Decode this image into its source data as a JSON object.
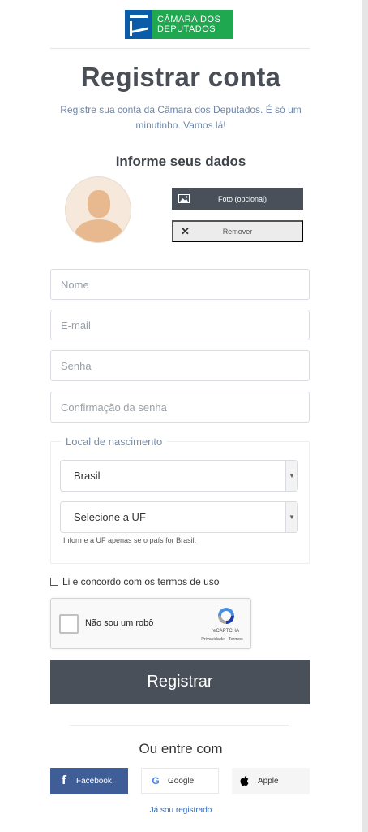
{
  "logo": {
    "line1": "CÂMARA DOS",
    "line2": "DEPUTADOS"
  },
  "title": "Registrar conta",
  "subtitle": "Registre sua conta da Câmara dos Deputados. É só um minutinho. Vamos lá!",
  "section_title": "Informe seus dados",
  "photo": {
    "upload_label": "Foto (opcional)",
    "remove_label": "Remover"
  },
  "form": {
    "name_placeholder": "Nome",
    "email_placeholder": "E-mail",
    "password_placeholder": "Senha",
    "confirm_placeholder": "Confirmação da senha"
  },
  "birthplace": {
    "legend": "Local de nascimento",
    "country_value": "Brasil",
    "uf_value": "Selecione a UF",
    "hint": "Informe a UF apenas se o país for Brasil."
  },
  "terms_label": "Li e concordo com os termos de uso",
  "recaptcha": {
    "label": "Não sou um robô",
    "brand": "reCAPTCHA",
    "links": "Privacidade - Termos"
  },
  "register_button": "Registrar",
  "or_title": "Ou entre com",
  "social": {
    "facebook": "Facebook",
    "google": "Google",
    "apple": "Apple"
  },
  "already_registered": "Já sou registrado",
  "colors": {
    "primary_button": "#4a505a",
    "facebook": "#3f5d96",
    "logo_green": "#1fa84f",
    "logo_blue": "#0a5ba8",
    "link": "#2d6cc4"
  }
}
